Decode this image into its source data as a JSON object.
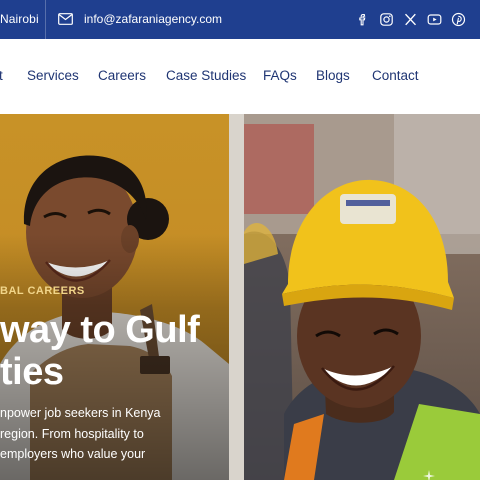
{
  "topbar": {
    "location": "Nairobi",
    "email": "info@zafaraniagency.com",
    "socials": [
      "facebook-icon",
      "instagram-icon",
      "x-icon",
      "youtube-icon",
      "pinterest-icon"
    ]
  },
  "nav": {
    "items": [
      "t",
      "Services",
      "Careers",
      "Case Studies",
      "FAQs",
      "Blogs",
      "Contact"
    ]
  },
  "hero": {
    "eyebrow": "BAL CAREERS",
    "headline_line1": "way to Gulf",
    "headline_line2": "ties",
    "description_lines": [
      "npower job seekers in Kenya",
      "region. From hospitality to",
      "employers who value your"
    ]
  },
  "colors": {
    "topbar_bg": "#1f3f8f",
    "nav_text": "#1f3573",
    "accent_gold": "#c89227",
    "eyebrow": "#f1d58a"
  }
}
